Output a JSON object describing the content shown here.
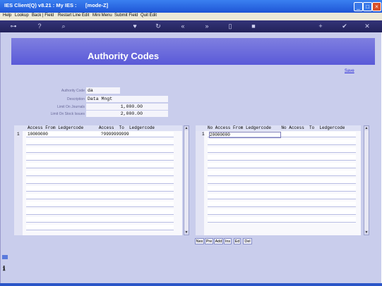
{
  "window": {
    "title": "IES Client(Q) v8.21 : My IES :      [mode-Z]"
  },
  "title_buttons": [
    "_",
    "□",
    "×"
  ],
  "menu": [
    "Help",
    "Lookup",
    "Back | Field",
    "Restart Line Edit",
    "Mini Menu",
    "Submit Field",
    "Quit Edit"
  ],
  "toolbar_icons": [
    "key-icon",
    "help-icon",
    "search-icon",
    "heart-icon",
    "refresh-icon",
    "back-icon",
    "forward-icon",
    "page-icon",
    "copy-icon",
    "add-icon",
    "check-icon",
    "close-icon"
  ],
  "toolbar_glyphs": [
    "⊶",
    "?",
    "⌕",
    "♥",
    "↻",
    "«",
    "»",
    "▯",
    "■",
    "+",
    "✔",
    "✕"
  ],
  "page": {
    "title": "Authority Codes",
    "save_label": "Save"
  },
  "form": {
    "authority_code_label": "Authority Code",
    "authority_code": "da",
    "description_label": "Description",
    "description": "Data Mngt",
    "limit_journals_label": "Limit On Journals",
    "limit_journals": "1,000.00",
    "limit_stock_issues_label": "Limit On Stock Issues",
    "limit_stock_issues": "2,000.00"
  },
  "access_grid": {
    "header": "Access From Ledgercode      Access  To  Ledgercode",
    "row_number": "1",
    "from": "10000000",
    "to": "?9999999999"
  },
  "no_access_grid": {
    "header": "No Access From Ledgercode    No Access  To  Ledgercode",
    "row_number": "1",
    "from": "20000000",
    "to": ""
  },
  "grid_buttons": [
    "Nex",
    "Pre",
    "Add",
    "Ins",
    "Ed",
    "Del"
  ]
}
